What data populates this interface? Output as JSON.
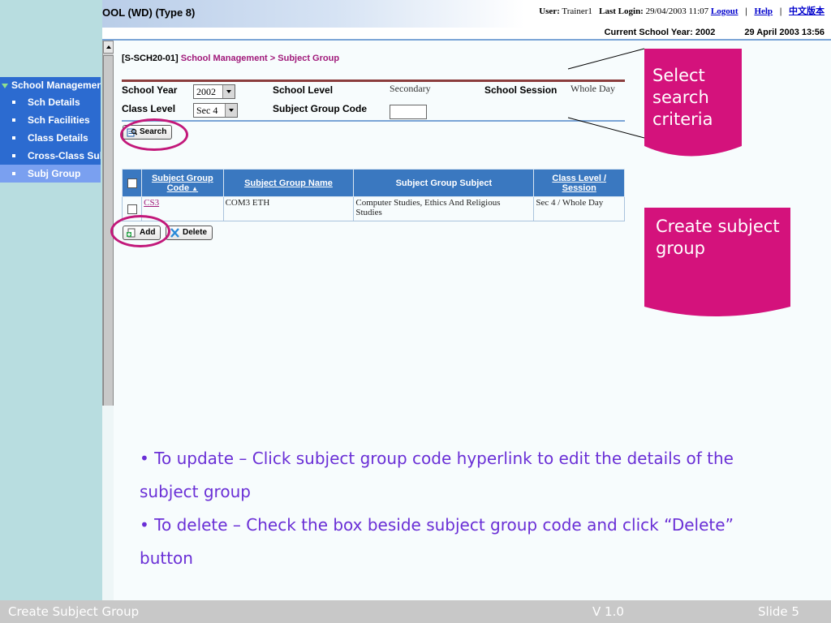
{
  "header": {
    "app_title": "OOL (WD) (Type 8)",
    "user_label": "User:",
    "user_name": "Trainer1",
    "last_login_label": "Last Login:",
    "last_login_value": "29/04/2003 11:07",
    "logout": "Logout",
    "help": "Help",
    "chinese": "中文版本",
    "current_year": "Current School Year: 2002",
    "datetime": "29 April 2003 13:56"
  },
  "sidebar": {
    "section": "School Managemen",
    "items": [
      {
        "label": "Sch Details"
      },
      {
        "label": "Sch Facilities"
      },
      {
        "label": "Class Details"
      },
      {
        "label": "Cross-Class Sul"
      },
      {
        "label": "Subj Group",
        "active": true
      }
    ]
  },
  "breadcrumb": {
    "code": "[S-SCH20-01]",
    "module": "School Management",
    "separator": " > ",
    "page": "Subject Group"
  },
  "criteria": {
    "school_year_label": "School Year",
    "school_year_value": "2002",
    "school_level_label": "School Level",
    "school_level_value": "Secondary",
    "school_session_label": "School Session",
    "school_session_value": "Whole Day",
    "class_level_label": "Class Level",
    "class_level_value": "Sec 4",
    "subject_group_code_label": "Subject Group Code",
    "subject_group_code_value": "",
    "search_button": "Search"
  },
  "table": {
    "headers": {
      "code_line1": "Subject Group",
      "code_line2": "Code",
      "name": "Subject Group Name",
      "subject": "Subject Group Subject",
      "level_line1": "Class Level /",
      "level_line2": "Session"
    },
    "rows": [
      {
        "code": "CS3",
        "name": "COM3 ETH",
        "subject_line1": "Computer Studies, Ethics And Religious",
        "subject_line2": "Studies",
        "level": "Sec 4 / Whole Day"
      }
    ]
  },
  "actions": {
    "add": "Add",
    "delete": "Delete"
  },
  "callouts": {
    "search_line1": "Select",
    "search_line2": "search",
    "search_line3": "criteria",
    "create_line1": "Create subject",
    "create_line2": "group"
  },
  "notes": {
    "update": "• To update – Click subject group code hyperlink to edit the details of the subject group",
    "delete": "• To delete – Check the box beside subject group code and click “Delete” button"
  },
  "footer": {
    "title": "Create Subject Group",
    "version": "V 1.0",
    "slide": "Slide 5"
  },
  "colors": {
    "accent_magenta": "#d4127c",
    "table_header_blue": "#3a78c0",
    "note_purple": "#6a2fd6",
    "nav_blue": "#2c6bd0"
  }
}
